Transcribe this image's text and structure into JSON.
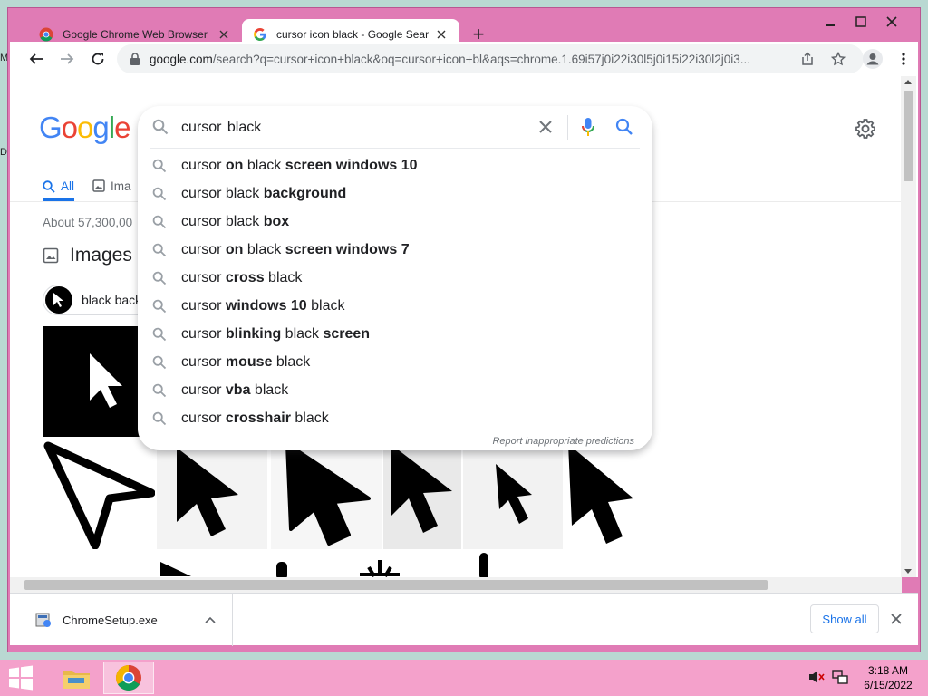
{
  "desktop": {
    "edge_marks": [
      "M",
      "D"
    ]
  },
  "browser": {
    "tabs": [
      {
        "title": "Google Chrome Web Browser",
        "active": false
      },
      {
        "title": "cursor icon black - Google Search",
        "active": true
      }
    ],
    "new_tab_label": "+",
    "address": {
      "host": "google.com",
      "path": "/search?q=cursor+icon+black&oq=cursor+icon+bl&aqs=chrome.1.69i57j0i22i30l5j0i15i22i30l2j0i3..."
    }
  },
  "page": {
    "logo": [
      "G",
      "o",
      "o",
      "g",
      "l",
      "e"
    ],
    "tabs": [
      {
        "label": "All",
        "active": true
      },
      {
        "label": "Ima",
        "active": false
      }
    ],
    "result_stats": "About 57,300,00",
    "images_heading": "Images",
    "chip_label": "black back"
  },
  "search": {
    "query_before_caret": "cursor ",
    "query_after_caret": "black",
    "suggestions": [
      {
        "parts": [
          [
            "cursor ",
            false
          ],
          [
            "on",
            true
          ],
          [
            " black ",
            false
          ],
          [
            "screen windows 10",
            true
          ]
        ]
      },
      {
        "parts": [
          [
            "cursor black ",
            false
          ],
          [
            "background",
            true
          ]
        ]
      },
      {
        "parts": [
          [
            "cursor black ",
            false
          ],
          [
            "box",
            true
          ]
        ]
      },
      {
        "parts": [
          [
            "cursor ",
            false
          ],
          [
            "on",
            true
          ],
          [
            " black ",
            false
          ],
          [
            "screen windows 7",
            true
          ]
        ]
      },
      {
        "parts": [
          [
            "cursor ",
            false
          ],
          [
            "cross",
            true
          ],
          [
            " black",
            false
          ]
        ]
      },
      {
        "parts": [
          [
            "cursor ",
            false
          ],
          [
            "windows 10",
            true
          ],
          [
            " black",
            false
          ]
        ]
      },
      {
        "parts": [
          [
            "cursor ",
            false
          ],
          [
            "blinking",
            true
          ],
          [
            " black ",
            false
          ],
          [
            "screen",
            true
          ]
        ]
      },
      {
        "parts": [
          [
            "cursor ",
            false
          ],
          [
            "mouse",
            true
          ],
          [
            " black",
            false
          ]
        ]
      },
      {
        "parts": [
          [
            "cursor ",
            false
          ],
          [
            "vba",
            true
          ],
          [
            " black",
            false
          ]
        ]
      },
      {
        "parts": [
          [
            "cursor ",
            false
          ],
          [
            "crosshair",
            true
          ],
          [
            " black",
            false
          ]
        ]
      }
    ],
    "report_link": "Report inappropriate predictions"
  },
  "downloads": {
    "file_name": "ChromeSetup.exe",
    "show_all": "Show all"
  },
  "taskbar": {
    "time": "3:18 AM",
    "date": "6/15/2022"
  },
  "colors": {
    "frame": "#e07bb5",
    "taskbar": "#f4a1cb",
    "link_blue": "#1a73e8"
  }
}
